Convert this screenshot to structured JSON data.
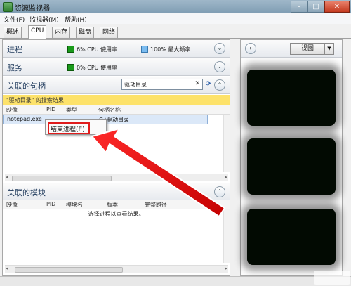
{
  "window": {
    "title": "资源监视器"
  },
  "menu": [
    "文件(F)",
    "监视器(M)",
    "帮助(H)"
  ],
  "tabs": [
    "概述",
    "CPU",
    "内存",
    "磁盘",
    "网络"
  ],
  "sections": {
    "processes": {
      "title": "进程",
      "cpu": "6% CPU 使用率",
      "freq": "100% 最大频率"
    },
    "services": {
      "title": "服务",
      "cpu": "0% CPU 使用率"
    },
    "handles": {
      "title": "关联的句柄",
      "search_value": "驱动目录",
      "result_banner": "\"驱动目录\" 的搜索结果"
    },
    "modules": {
      "title": "关联的模块"
    }
  },
  "handles_table": {
    "headers": [
      "映像",
      "PID",
      "类型",
      "句柄名称"
    ],
    "rows": [
      {
        "image": "notepad.exe",
        "pid": "",
        "type": "",
        "name": "C:\\驱动目录"
      }
    ]
  },
  "context_menu": {
    "item": "结束进程(E)"
  },
  "modules_table": {
    "headers": [
      "映像",
      "PID",
      "模块名",
      "版本",
      "完整路径"
    ],
    "empty_message": "选择进程以查看结果。"
  },
  "right_panel": {
    "view_button": "视图"
  },
  "colors": {
    "highlight": "#e01b1b",
    "banner": "#fde26a",
    "cpu_green": "#1a9a1a",
    "freq_blue": "#7bbcf0"
  }
}
